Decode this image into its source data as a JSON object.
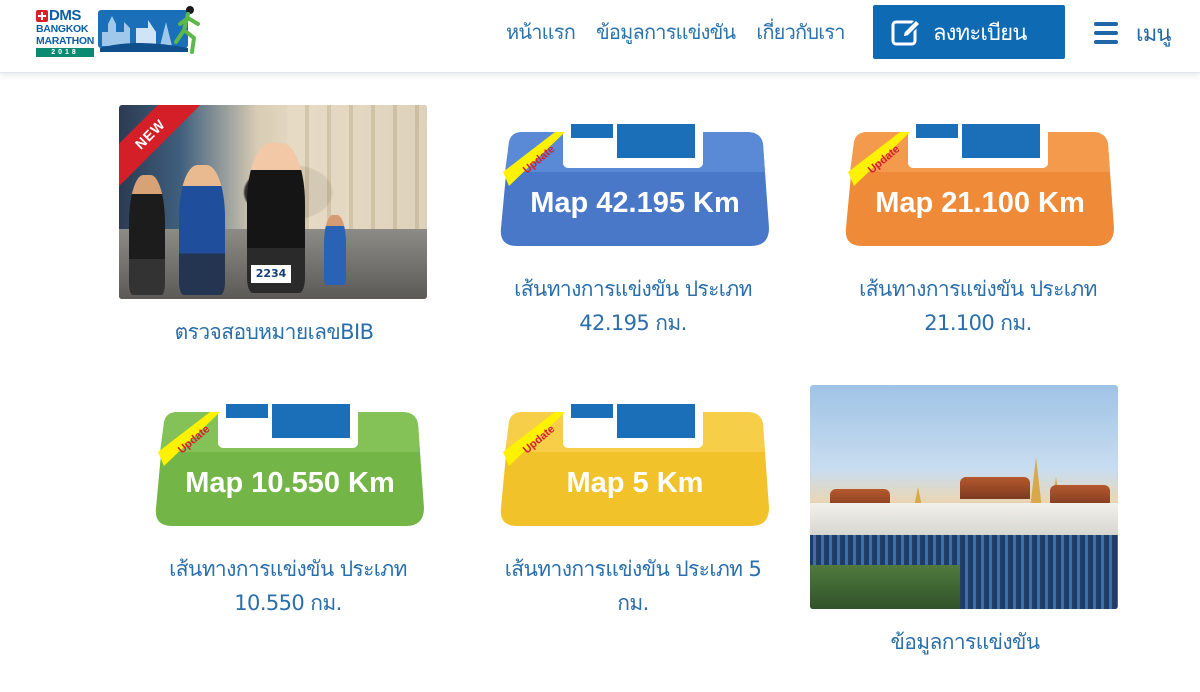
{
  "header": {
    "logo": {
      "brand": "DMS",
      "city": "BANGKOK",
      "event": "MARATHON",
      "year": "2018"
    },
    "nav": [
      {
        "label": "หน้าแรก"
      },
      {
        "label": "ข้อมูลการแข่งขัน"
      },
      {
        "label": "เกี่ยวกับเรา"
      }
    ],
    "register_label": "ลงทะเบียน",
    "menu_label": "เมนู",
    "accent_color": "#0f6ab4"
  },
  "cards": [
    {
      "caption": "ตรวจสอบหมายเลขBIB",
      "ribbon": "NEW",
      "bib": "2234",
      "image": "runners-photo"
    },
    {
      "caption": "เส้นทางการแข่งขัน ประเภท 42.195 กม.",
      "badge_text": "Map 42.195 Km",
      "tag": "Update",
      "color": "#4a78c8"
    },
    {
      "caption": "เส้นทางการแข่งขัน ประเภท 21.100 กม.",
      "badge_text": "Map 21.100 Km",
      "tag": "Update",
      "color": "#ee8a38"
    },
    {
      "caption": "เส้นทางการแข่งขัน ประเภท 10.550 กม.",
      "badge_text": "Map 10.550 Km",
      "tag": "Update",
      "color": "#74b548"
    },
    {
      "caption": "เส้นทางการแข่งขัน ประเภท 5 กม.",
      "badge_text": "Map 5 Km",
      "tag": "Update",
      "color": "#f2c22b"
    },
    {
      "caption": "ข้อมูลการแข่งขัน",
      "image": "grand-palace-photo"
    }
  ]
}
